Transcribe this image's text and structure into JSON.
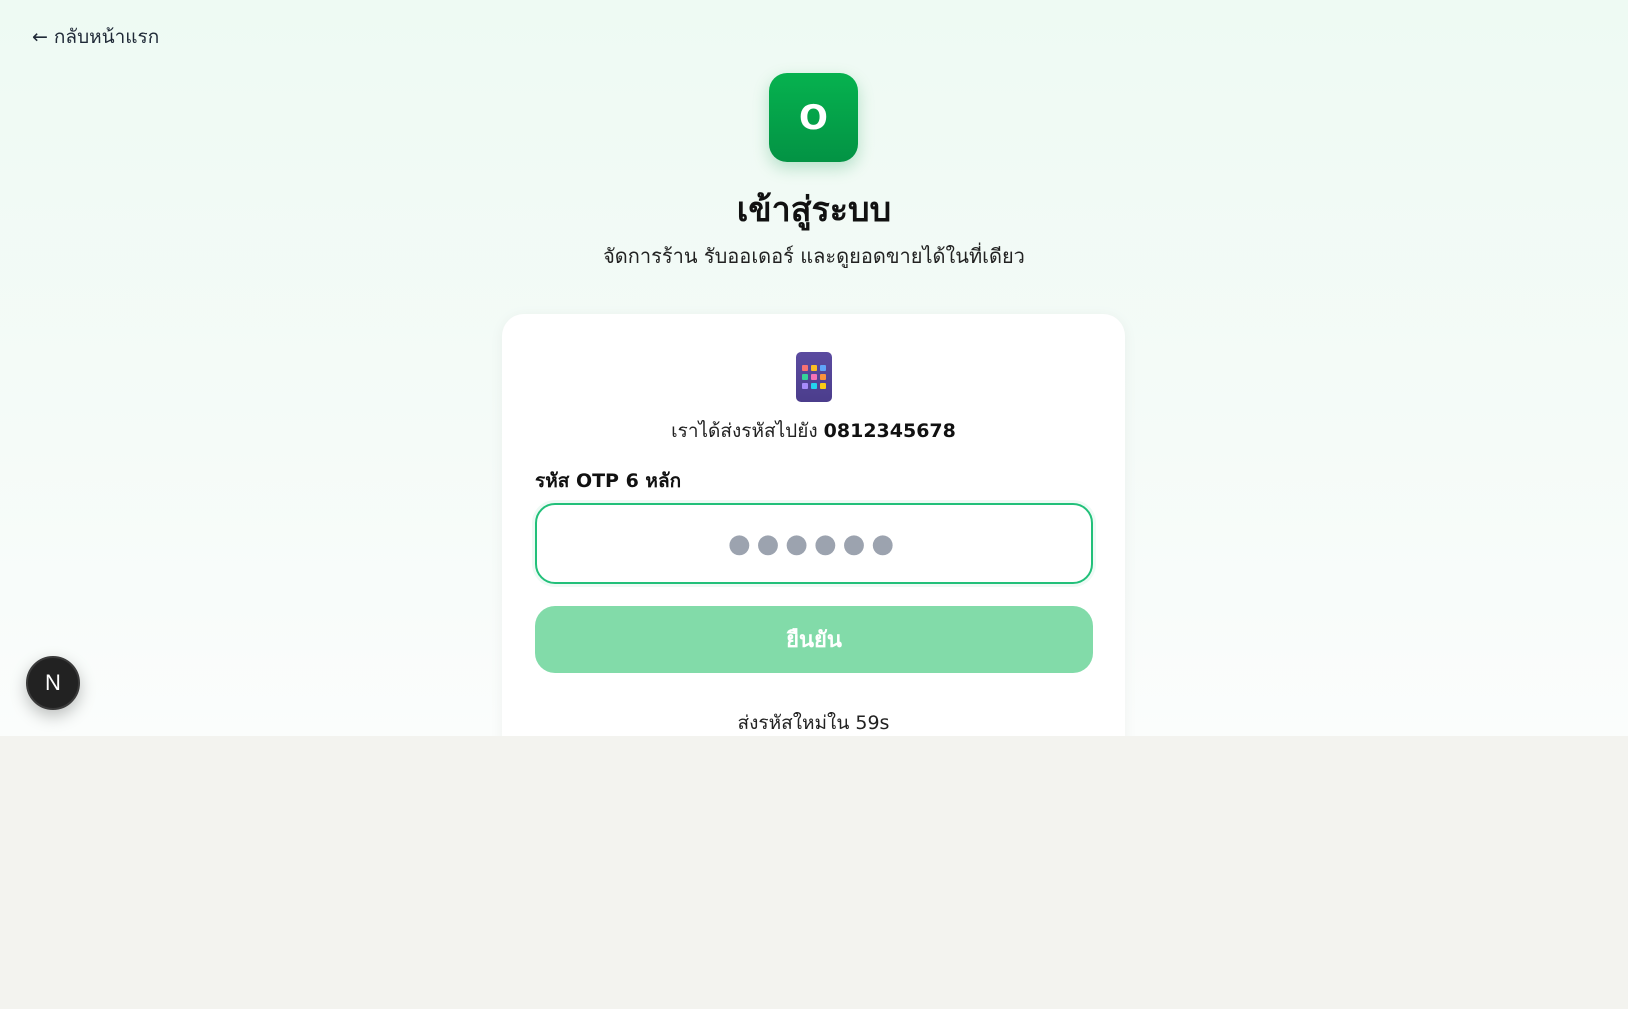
{
  "nav": {
    "back_label": "กลับหน้าแรก",
    "back_arrow": "←"
  },
  "brand": {
    "logo_letter": "O",
    "color": "#04a84a"
  },
  "header": {
    "title": "เข้าสู่ระบบ",
    "subtitle": "จัดการร้าน รับออเดอร์ และดูยอดขายได้ในที่เดียว"
  },
  "otp": {
    "icon": "mobile-phone-icon",
    "sent_text": "เราได้ส่งรหัสไปยัง ",
    "phone": "0812345678",
    "label": "รหัส OTP 6 หลัก",
    "placeholder": "●●●●●●",
    "value": "",
    "confirm_label": "ยืนยัน",
    "resend_text": "ส่งรหัสใหม่ใน 59s"
  },
  "dev_badge": {
    "letter": "N",
    "icon": "nextjs-icon"
  },
  "colors": {
    "accent": "#22c07a",
    "button_disabled": "#82dba9",
    "background_lower": "#f3f3ef"
  }
}
